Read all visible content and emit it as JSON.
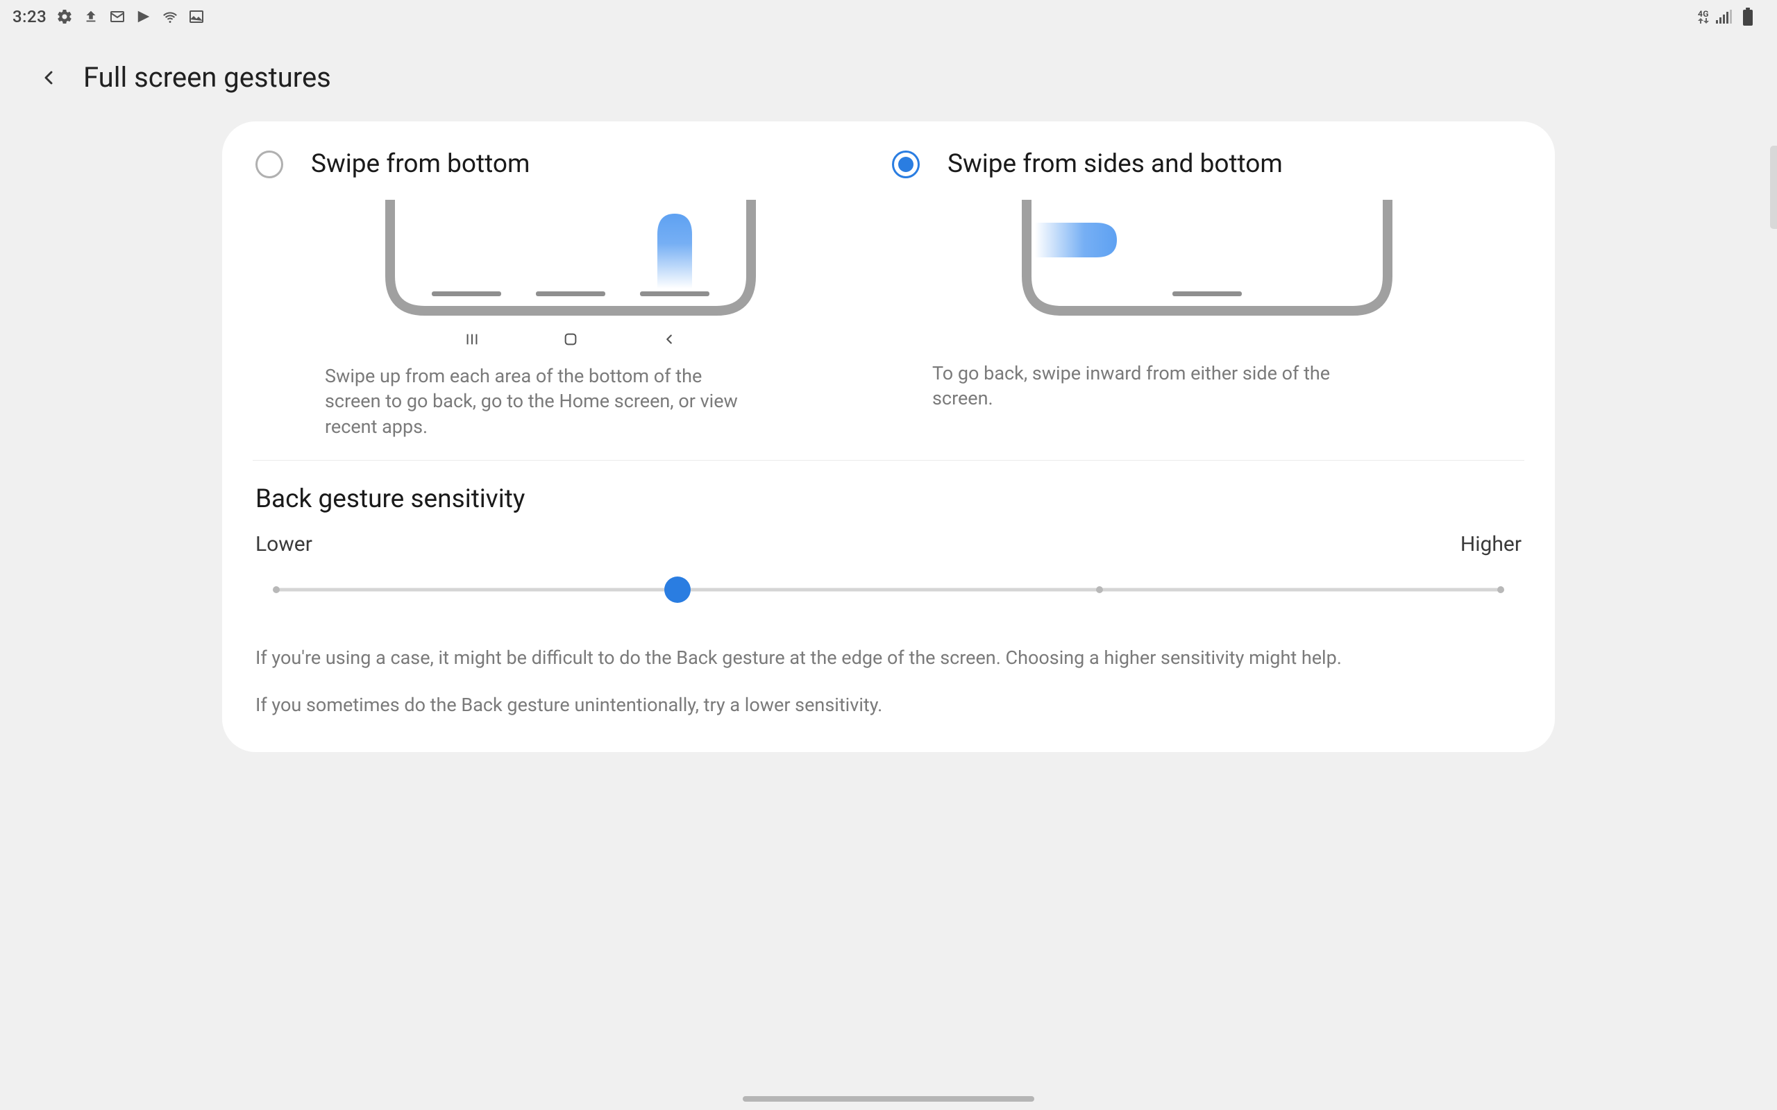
{
  "status": {
    "time": "3:23",
    "network_label": "4G",
    "icons_left": [
      "settings",
      "upload",
      "mail",
      "play",
      "wifi",
      "picture"
    ],
    "icons_right": [
      "lte",
      "signal",
      "battery"
    ]
  },
  "header": {
    "title": "Full screen gestures"
  },
  "options": {
    "bottom": {
      "label": "Swipe from bottom",
      "selected": false,
      "description": "Swipe up from each area of the bottom of the screen to go back, go to the Home screen, or view recent apps."
    },
    "sides": {
      "label": "Swipe from sides and bottom",
      "selected": true,
      "description": "To go back, swipe inward from either side of the screen."
    }
  },
  "sensitivity": {
    "title": "Back gesture sensitivity",
    "lower_label": "Lower",
    "higher_label": "Higher",
    "ticks": 4,
    "value_index": 1,
    "help1": "If you're using a case, it might be difficult to do the Back gesture at the edge of the screen. Choosing a higher sensitivity might help.",
    "help2": "If you sometimes do the Back gesture unintentionally, try a lower sensitivity."
  }
}
